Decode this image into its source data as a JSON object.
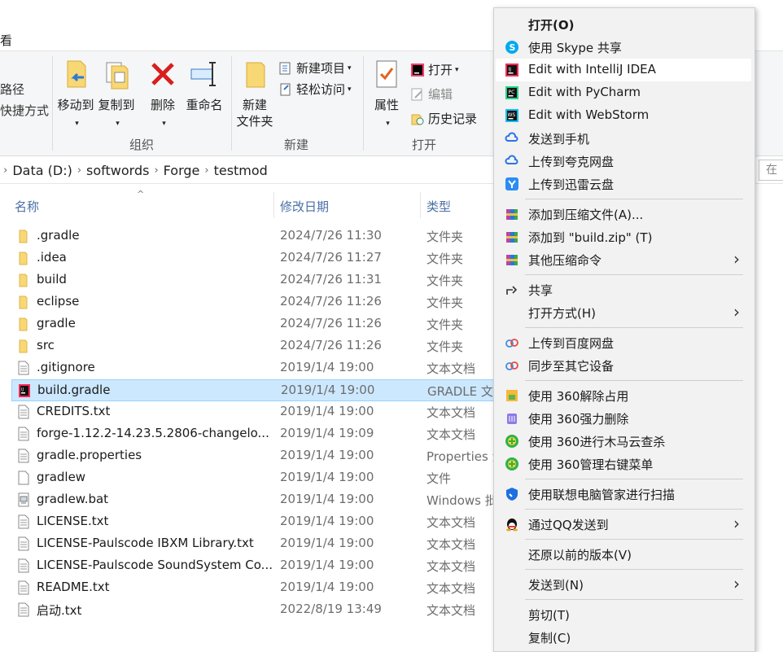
{
  "ribbon": {
    "tab_view": "看",
    "left_items": [
      "路径",
      "快捷方式"
    ],
    "organize": {
      "move_to": "移动到",
      "copy_to": "复制到",
      "delete": "删除",
      "rename": "重命名",
      "label": "组织"
    },
    "new": {
      "new_folder_line1": "新建",
      "new_folder_line2": "文件夹",
      "new_item": "新建项目",
      "easy_access": "轻松访问",
      "label": "新建"
    },
    "open": {
      "properties": "属性",
      "open": "打开",
      "edit": "编辑",
      "history": "历史记录",
      "label": "打开"
    }
  },
  "address": {
    "crumbs": [
      "Data (D:)",
      "softwords",
      "Forge",
      "testmod"
    ],
    "search_placeholder": "在"
  },
  "columns": {
    "name": "名称",
    "date": "修改日期",
    "type": "类型"
  },
  "files": [
    {
      "name": ".gradle",
      "date": "2024/7/26 11:30",
      "type": "文件夹",
      "icon": "folder-icon"
    },
    {
      "name": ".idea",
      "date": "2024/7/26 11:27",
      "type": "文件夹",
      "icon": "folder-icon"
    },
    {
      "name": "build",
      "date": "2024/7/26 11:31",
      "type": "文件夹",
      "icon": "folder-icon"
    },
    {
      "name": "eclipse",
      "date": "2024/7/26 11:26",
      "type": "文件夹",
      "icon": "folder-icon"
    },
    {
      "name": "gradle",
      "date": "2024/7/26 11:26",
      "type": "文件夹",
      "icon": "folder-icon"
    },
    {
      "name": "src",
      "date": "2024/7/26 11:26",
      "type": "文件夹",
      "icon": "folder-icon"
    },
    {
      "name": ".gitignore",
      "date": "2019/1/4 19:00",
      "type": "文本文档",
      "icon": "text-file-icon"
    },
    {
      "name": "build.gradle",
      "date": "2019/1/4 19:00",
      "type": "GRADLE 文件",
      "icon": "intellij-file-icon",
      "selected": true
    },
    {
      "name": "CREDITS.txt",
      "date": "2019/1/4 19:00",
      "type": "文本文档",
      "icon": "text-file-icon"
    },
    {
      "name": "forge-1.12.2-14.23.5.2806-changelo...",
      "date": "2019/1/4 19:09",
      "type": "文本文档",
      "icon": "text-file-icon"
    },
    {
      "name": "gradle.properties",
      "date": "2019/1/4 19:00",
      "type": "Properties 源文件",
      "icon": "text-file-icon"
    },
    {
      "name": "gradlew",
      "date": "2019/1/4 19:00",
      "type": "文件",
      "icon": "blank-file-icon"
    },
    {
      "name": "gradlew.bat",
      "date": "2019/1/4 19:00",
      "type": "Windows 批处理文件",
      "icon": "bat-file-icon"
    },
    {
      "name": "LICENSE.txt",
      "date": "2019/1/4 19:00",
      "type": "文本文档",
      "icon": "text-file-icon"
    },
    {
      "name": "LICENSE-Paulscode IBXM Library.txt",
      "date": "2019/1/4 19:00",
      "type": "文本文档",
      "icon": "text-file-icon"
    },
    {
      "name": "LICENSE-Paulscode SoundSystem Co...",
      "date": "2019/1/4 19:00",
      "type": "文本文档",
      "icon": "text-file-icon"
    },
    {
      "name": "README.txt",
      "date": "2019/1/4 19:00",
      "type": "文本文档",
      "icon": "text-file-icon"
    },
    {
      "name": "启动.txt",
      "date": "2022/8/19 13:49",
      "type": "文本文档",
      "icon": "text-file-icon"
    }
  ],
  "menu": [
    {
      "label": "打开(O)",
      "bold": true
    },
    {
      "label": "使用 Skype 共享",
      "icon": "skype-icon"
    },
    {
      "label": "Edit with IntelliJ IDEA",
      "icon": "intellij-icon",
      "highlight": true
    },
    {
      "label": "Edit with PyCharm",
      "icon": "pycharm-icon"
    },
    {
      "label": "Edit with WebStorm",
      "icon": "webstorm-icon"
    },
    {
      "label": "发送到手机",
      "icon": "cloud-phone-icon"
    },
    {
      "label": "上传到夸克网盘",
      "icon": "quark-icon"
    },
    {
      "label": "上传到迅雷云盘",
      "icon": "xunlei-icon",
      "sep_after": true
    },
    {
      "label": "添加到压缩文件(A)...",
      "icon": "archive-icon"
    },
    {
      "label": "添加到 \"build.zip\" (T)",
      "icon": "archive-icon"
    },
    {
      "label": "其他压缩命令",
      "icon": "archive-icon",
      "submenu": true,
      "sep_after": true
    },
    {
      "label": "共享",
      "icon": "share-icon"
    },
    {
      "label": "打开方式(H)",
      "submenu": true,
      "sep_after": true
    },
    {
      "label": "上传到百度网盘",
      "icon": "baidu-icon"
    },
    {
      "label": "同步至其它设备",
      "icon": "baidu-icon",
      "sep_after": true
    },
    {
      "label": "使用 360解除占用",
      "icon": "unlock-360-icon"
    },
    {
      "label": "使用 360强力删除",
      "icon": "delete-360-icon"
    },
    {
      "label": "使用 360进行木马云查杀",
      "icon": "scan-360-icon"
    },
    {
      "label": "使用 360管理右键菜单",
      "icon": "scan-360-icon",
      "sep_after": true
    },
    {
      "label": "使用联想电脑管家进行扫描",
      "icon": "lenovo-shield-icon",
      "sep_after": true
    },
    {
      "label": "通过QQ发送到",
      "icon": "qq-icon",
      "submenu": true,
      "sep_after": true
    },
    {
      "label": "还原以前的版本(V)",
      "sep_after": true
    },
    {
      "label": "发送到(N)",
      "submenu": true,
      "sep_after": true
    },
    {
      "label": "剪切(T)"
    },
    {
      "label": "复制(C)"
    }
  ]
}
